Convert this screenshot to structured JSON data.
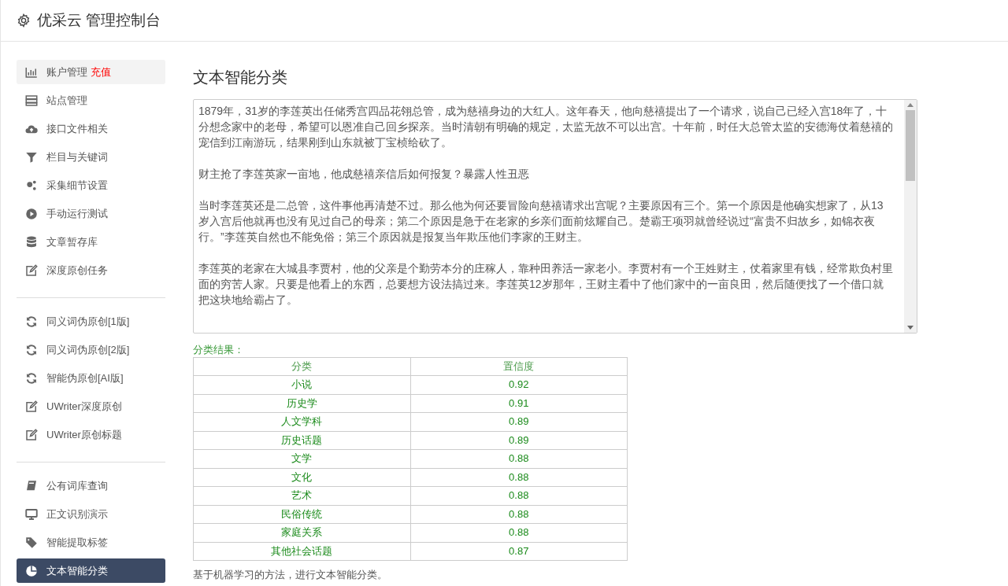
{
  "header": {
    "title": "优采云 管理控制台"
  },
  "sidebar": {
    "groups": [
      [
        {
          "label": "账户管理",
          "badge": "充值",
          "selected": false,
          "highlight": true
        },
        {
          "label": "站点管理",
          "selected": false,
          "highlight": false
        },
        {
          "label": "接口文件相关",
          "selected": false,
          "highlight": false
        },
        {
          "label": "栏目与关键词",
          "selected": false,
          "highlight": false
        },
        {
          "label": "采集细节设置",
          "selected": false,
          "highlight": false
        },
        {
          "label": "手动运行测试",
          "selected": false,
          "highlight": false
        },
        {
          "label": "文章暂存库",
          "selected": false,
          "highlight": false
        },
        {
          "label": "深度原创任务",
          "selected": false,
          "highlight": false
        }
      ],
      [
        {
          "label": "同义词伪原创[1版]",
          "selected": false,
          "highlight": false
        },
        {
          "label": "同义词伪原创[2版]",
          "selected": false,
          "highlight": false
        },
        {
          "label": "智能伪原创[AI版]",
          "selected": false,
          "highlight": false
        },
        {
          "label": "UWriter深度原创",
          "selected": false,
          "highlight": false
        },
        {
          "label": "UWriter原创标题",
          "selected": false,
          "highlight": false
        }
      ],
      [
        {
          "label": "公有词库查询",
          "selected": false,
          "highlight": false
        },
        {
          "label": "正文识别演示",
          "selected": false,
          "highlight": false
        },
        {
          "label": "智能提取标签",
          "selected": false,
          "highlight": false
        },
        {
          "label": "文本智能分类",
          "selected": true,
          "highlight": false
        }
      ]
    ]
  },
  "main": {
    "title": "文本智能分类",
    "text_input": {
      "paragraphs": [
        "1879年，31岁的李莲英出任储秀宫四品花翎总管，成为慈禧身边的大红人。这年春天，他向慈禧提出了一个请求，说自己已经入宫18年了，十分想念家中的老母，希望可以恩准自己回乡探亲。当时清朝有明确的规定，太监无故不可以出宫。十年前，时任大总管太监的安德海仗着慈禧的宠信到江南游玩，结果刚到山东就被丁宝桢给砍了。",
        "财主抢了李莲英家一亩地，他成慈禧亲信后如何报复？暴露人性丑恶",
        "当时李莲英还是二总管，这件事他再清楚不过。那么他为何还要冒险向慈禧请求出宫呢？主要原因有三个。第一个原因是他确实想家了，从13岁入宫后他就再也没有见过自己的母亲；第二个原因是急于在老家的乡亲们面前炫耀自己。楚霸王项羽就曾经说过“富贵不归故乡，如锦衣夜行。”李莲英自然也不能免俗；第三个原因就是报复当年欺压他们李家的王财主。",
        "李莲英的老家在大城县李贾村，他的父亲是个勤劳本分的庄稼人，靠种田养活一家老小。李贾村有一个王姓财主，仗着家里有钱，经常欺负村里面的穷苦人家。只要是他看上的东西，总要想方设法搞过来。李莲英12岁那年，王财主看中了他们家中的一亩良田，然后随便找了一个借口就把这块地给霸占了。"
      ]
    },
    "result_label": "分类结果：",
    "table": {
      "columns": [
        "分类",
        "置信度"
      ],
      "rows": [
        [
          "小说",
          "0.92"
        ],
        [
          "历史学",
          "0.91"
        ],
        [
          "人文学科",
          "0.89"
        ],
        [
          "历史话题",
          "0.89"
        ],
        [
          "文学",
          "0.88"
        ],
        [
          "文化",
          "0.88"
        ],
        [
          "艺术",
          "0.88"
        ],
        [
          "民俗传统",
          "0.88"
        ],
        [
          "家庭关系",
          "0.88"
        ],
        [
          "其他社会话题",
          "0.87"
        ]
      ]
    },
    "note": "基于机器学习的方法，进行文本智能分类。"
  }
}
